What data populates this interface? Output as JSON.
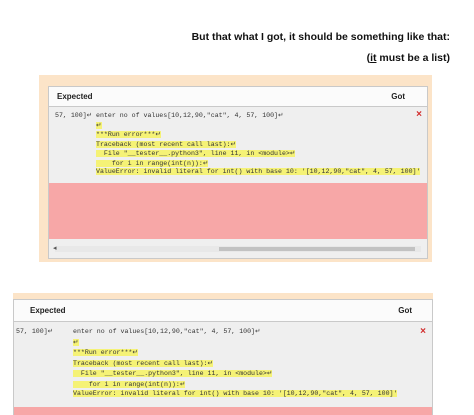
{
  "header": {
    "line1": "But that what I got, it should be something like that:",
    "line2_prefix": "(",
    "line2_underlined": "it",
    "line2_suffix": " must be a list)"
  },
  "table_header": {
    "expected": "Expected",
    "got": "Got"
  },
  "panel1": {
    "expected_cell": "57, 100]↵",
    "got_lines": [
      "enter no of values[10,12,90,\"cat\", 4, 57, 100]↵",
      "↵",
      "***Run error***↵",
      "Traceback (most recent call last):↵",
      "  File \"__tester__.python3\", line 11, in <module>↵",
      "    for i in range(int(n)):↵",
      "ValueError: invalid literal for int() with base 10: '[10,12,90,\"cat\", 4, 57, 100]'"
    ],
    "status_icon": "×"
  },
  "panel2": {
    "expected_cell": "57, 100]↵",
    "got_lines": [
      "enter no of values[10,12,90,\"cat\", 4, 57, 100]↵",
      "↵",
      "***Run error***↵",
      "Traceback (most recent call last):↵",
      "  File \"__tester__.python3\", line 11, in <module>↵",
      "    for i in range(int(n)):↵",
      "ValueError: invalid literal for int() with base 10: '[10,12,90,\"cat\", 4, 57, 100]'"
    ],
    "status_icon": "×"
  },
  "colors": {
    "panel_background": "#fce4c8",
    "failure_pink": "#f7a7a7",
    "highlight": "#f5f276",
    "fail_mark": "#d22c2c"
  },
  "icons": {
    "fail": "close-icon",
    "scroll_left": "chevron-left-icon"
  }
}
